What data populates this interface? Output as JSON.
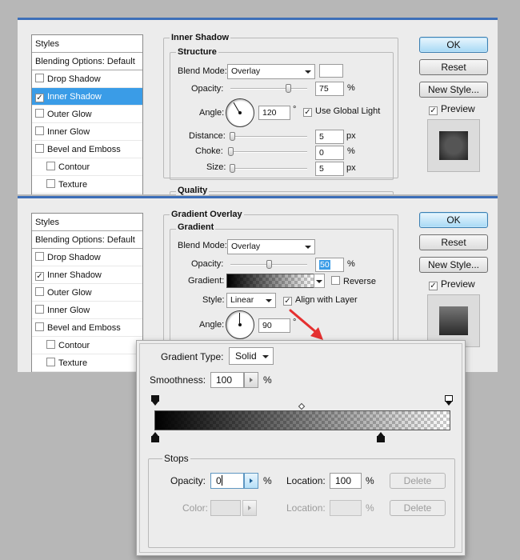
{
  "panel1": {
    "styles_list": [
      {
        "label": "Styles",
        "checkbox": false,
        "checked": false,
        "selected": false,
        "indent": false,
        "kind": "header"
      },
      {
        "label": "Blending Options: Default",
        "checkbox": false,
        "checked": false,
        "selected": false,
        "indent": false,
        "kind": "blend"
      },
      {
        "label": "Drop Shadow",
        "checkbox": true,
        "checked": false,
        "selected": false,
        "indent": false,
        "kind": "item"
      },
      {
        "label": "Inner Shadow",
        "checkbox": true,
        "checked": true,
        "selected": true,
        "indent": false,
        "kind": "item"
      },
      {
        "label": "Outer Glow",
        "checkbox": true,
        "checked": false,
        "selected": false,
        "indent": false,
        "kind": "item"
      },
      {
        "label": "Inner Glow",
        "checkbox": true,
        "checked": false,
        "selected": false,
        "indent": false,
        "kind": "item"
      },
      {
        "label": "Bevel and Emboss",
        "checkbox": true,
        "checked": false,
        "selected": false,
        "indent": false,
        "kind": "item"
      },
      {
        "label": "Contour",
        "checkbox": true,
        "checked": false,
        "selected": false,
        "indent": true,
        "kind": "item"
      },
      {
        "label": "Texture",
        "checkbox": true,
        "checked": false,
        "selected": false,
        "indent": true,
        "kind": "item"
      }
    ],
    "section_title": "Inner Shadow",
    "group_title": "Structure",
    "blend_mode_label": "Blend Mode:",
    "blend_mode_value": "Overlay",
    "opacity_label": "Opacity:",
    "opacity_value": "75",
    "opacity_fraction": 0.75,
    "percent": "%",
    "angle_label": "Angle:",
    "angle_value": "120",
    "degree": "°",
    "use_global_light_label": "Use Global Light",
    "distance_label": "Distance:",
    "distance_value": "5",
    "distance_fraction": 0.02,
    "choke_label": "Choke:",
    "choke_value": "0",
    "choke_fraction": 0.0,
    "size_label": "Size:",
    "size_value": "5",
    "size_fraction": 0.02,
    "px": "px",
    "quality_title": "Quality",
    "ok_label": "OK",
    "reset_label": "Reset",
    "new_style_label": "New Style...",
    "preview_label": "Preview"
  },
  "panel2": {
    "styles_list": [
      {
        "label": "Styles",
        "checkbox": false,
        "checked": false,
        "selected": false,
        "indent": false,
        "kind": "header"
      },
      {
        "label": "Blending Options: Default",
        "checkbox": false,
        "checked": false,
        "selected": false,
        "indent": false,
        "kind": "blend"
      },
      {
        "label": "Drop Shadow",
        "checkbox": true,
        "checked": false,
        "selected": false,
        "indent": false,
        "kind": "item"
      },
      {
        "label": "Inner Shadow",
        "checkbox": true,
        "checked": true,
        "selected": false,
        "indent": false,
        "kind": "item"
      },
      {
        "label": "Outer Glow",
        "checkbox": true,
        "checked": false,
        "selected": false,
        "indent": false,
        "kind": "item"
      },
      {
        "label": "Inner Glow",
        "checkbox": true,
        "checked": false,
        "selected": false,
        "indent": false,
        "kind": "item"
      },
      {
        "label": "Bevel and Emboss",
        "checkbox": true,
        "checked": false,
        "selected": false,
        "indent": false,
        "kind": "item"
      },
      {
        "label": "Contour",
        "checkbox": true,
        "checked": false,
        "selected": false,
        "indent": true,
        "kind": "item"
      },
      {
        "label": "Texture",
        "checkbox": true,
        "checked": false,
        "selected": false,
        "indent": true,
        "kind": "item"
      }
    ],
    "section_title": "Gradient Overlay",
    "group_title": "Gradient",
    "blend_mode_label": "Blend Mode:",
    "blend_mode_value": "Overlay",
    "opacity_label": "Opacity:",
    "opacity_value": "50",
    "opacity_fraction": 0.5,
    "percent": "%",
    "gradient_label": "Gradient:",
    "reverse_label": "Reverse",
    "style_label": "Style:",
    "style_value": "Linear",
    "align_with_layer_label": "Align with Layer",
    "angle_label": "Angle:",
    "angle_value": "90",
    "degree": "°",
    "ok_label": "OK",
    "reset_label": "Reset",
    "new_style_label": "New Style...",
    "preview_label": "Preview"
  },
  "gradient_editor": {
    "gradient_type_label": "Gradient Type:",
    "gradient_type_value": "Solid",
    "smoothness_label": "Smoothness:",
    "smoothness_value": "100",
    "percent": "%",
    "stops_title": "Stops",
    "opacity_label": "Opacity:",
    "opacity_value": "0",
    "location_label": "Location:",
    "location_value": "100",
    "delete_label": "Delete",
    "color_label": "Color:",
    "color_location_label": "Location:",
    "color_location_value": "",
    "color_delete_label": "Delete"
  },
  "colors": {
    "window_bg": "#ececec",
    "selection_blue": "#3a9ce7",
    "title_bar_blue": "#3d6fb8",
    "arrow_red": "#e53030"
  }
}
